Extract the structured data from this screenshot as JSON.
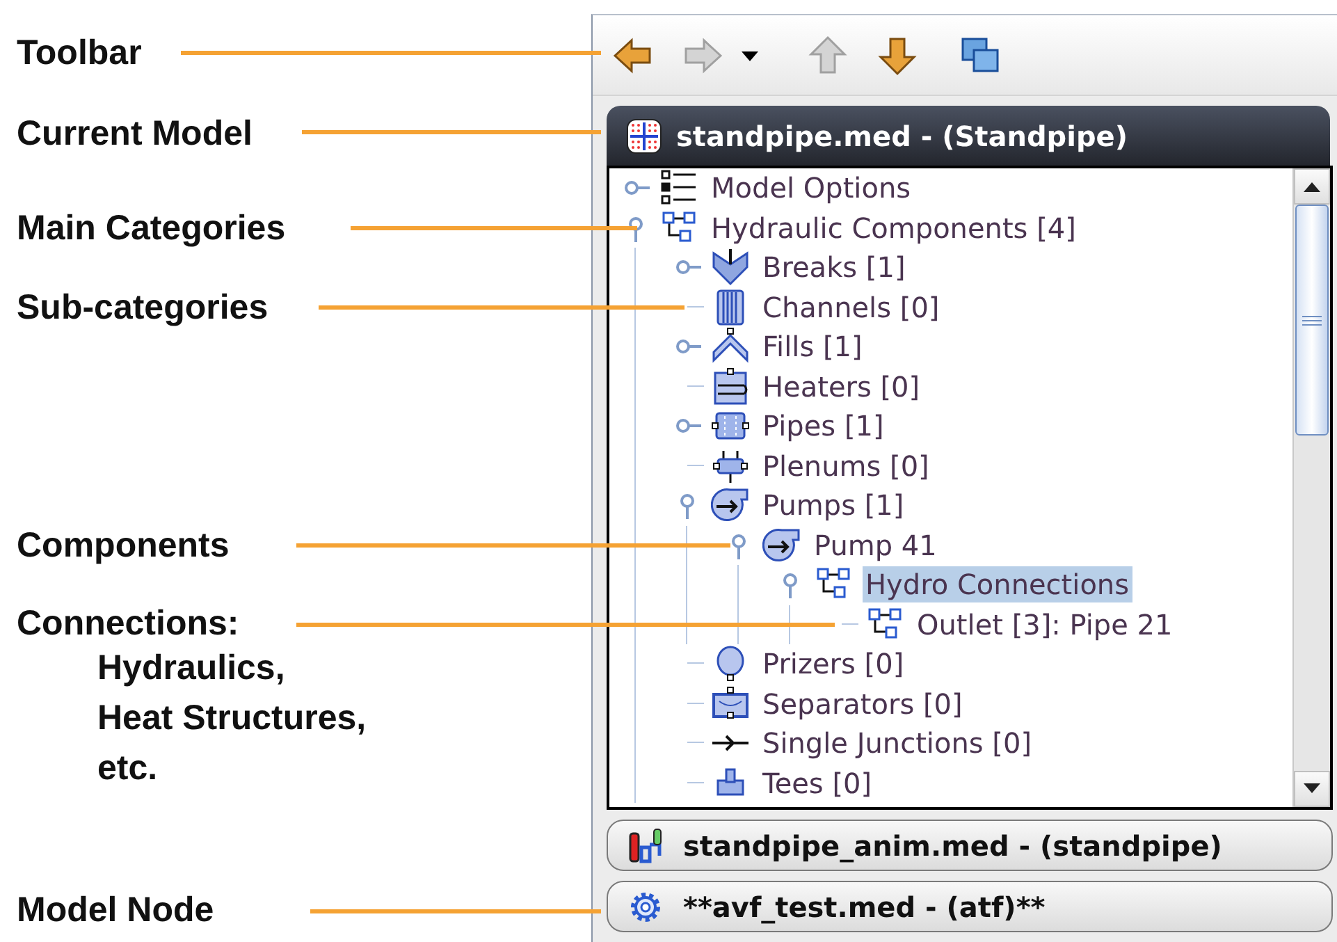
{
  "annotations": [
    {
      "label": "Toolbar"
    },
    {
      "label": "Current Model"
    },
    {
      "label": "Main Categories"
    },
    {
      "label": "Sub-categories"
    },
    {
      "label": "Components"
    },
    {
      "label": "Connections:",
      "details": [
        "Hydraulics,",
        "Heat Structures,",
        "etc."
      ]
    },
    {
      "label": "Model Node"
    }
  ],
  "toolbar": [
    {
      "kind": "back",
      "disabled": false
    },
    {
      "kind": "forward",
      "disabled": true
    },
    {
      "kind": "menu",
      "disabled": false
    },
    {
      "kind": "up",
      "disabled": true
    },
    {
      "kind": "down",
      "disabled": false
    },
    {
      "kind": "windows",
      "disabled": false
    }
  ],
  "models": [
    {
      "name": "standpipe.med - (Standpipe)",
      "kind": "grid",
      "selected": true
    },
    {
      "name": "standpipe_anim.med - (standpipe)",
      "kind": "anim",
      "selected": false
    },
    {
      "name": "**avf_test.med - (atf)**",
      "kind": "gear",
      "selected": false
    }
  ],
  "tree": {
    "items": [
      {
        "label": "Model Options",
        "kind": "options",
        "expanded": false,
        "selected": false
      },
      {
        "label": "Hydraulic Components [4]",
        "kind": "network",
        "expanded": true,
        "selected": false,
        "children": [
          {
            "label": "Breaks [1]",
            "kind": "breaks",
            "expanded": false,
            "selected": false
          },
          {
            "label": "Channels [0]",
            "kind": "channels",
            "selected": false
          },
          {
            "label": "Fills [1]",
            "kind": "fills",
            "expanded": false,
            "selected": false
          },
          {
            "label": "Heaters [0]",
            "kind": "heaters",
            "selected": false
          },
          {
            "label": "Pipes [1]",
            "kind": "pipes",
            "expanded": false,
            "selected": false
          },
          {
            "label": "Plenums [0]",
            "kind": "plenums",
            "selected": false
          },
          {
            "label": "Pumps [1]",
            "kind": "pumps",
            "expanded": true,
            "selected": false,
            "children": [
              {
                "label": "Pump 41",
                "kind": "pumps",
                "expanded": true,
                "selected": false,
                "children": [
                  {
                    "label": "Hydro Connections",
                    "kind": "network",
                    "expanded": true,
                    "selected": true,
                    "children": [
                      {
                        "label": "Outlet [3]: Pipe 21",
                        "kind": "network",
                        "selected": false
                      }
                    ]
                  }
                ]
              }
            ]
          },
          {
            "label": "Prizers [0]",
            "kind": "prizers",
            "selected": false
          },
          {
            "label": "Separators [0]",
            "kind": "separators",
            "selected": false
          },
          {
            "label": "Single Junctions [0]",
            "kind": "junctions",
            "selected": false
          },
          {
            "label": "Tees [0]",
            "kind": "tees",
            "selected": false
          }
        ]
      }
    ]
  }
}
